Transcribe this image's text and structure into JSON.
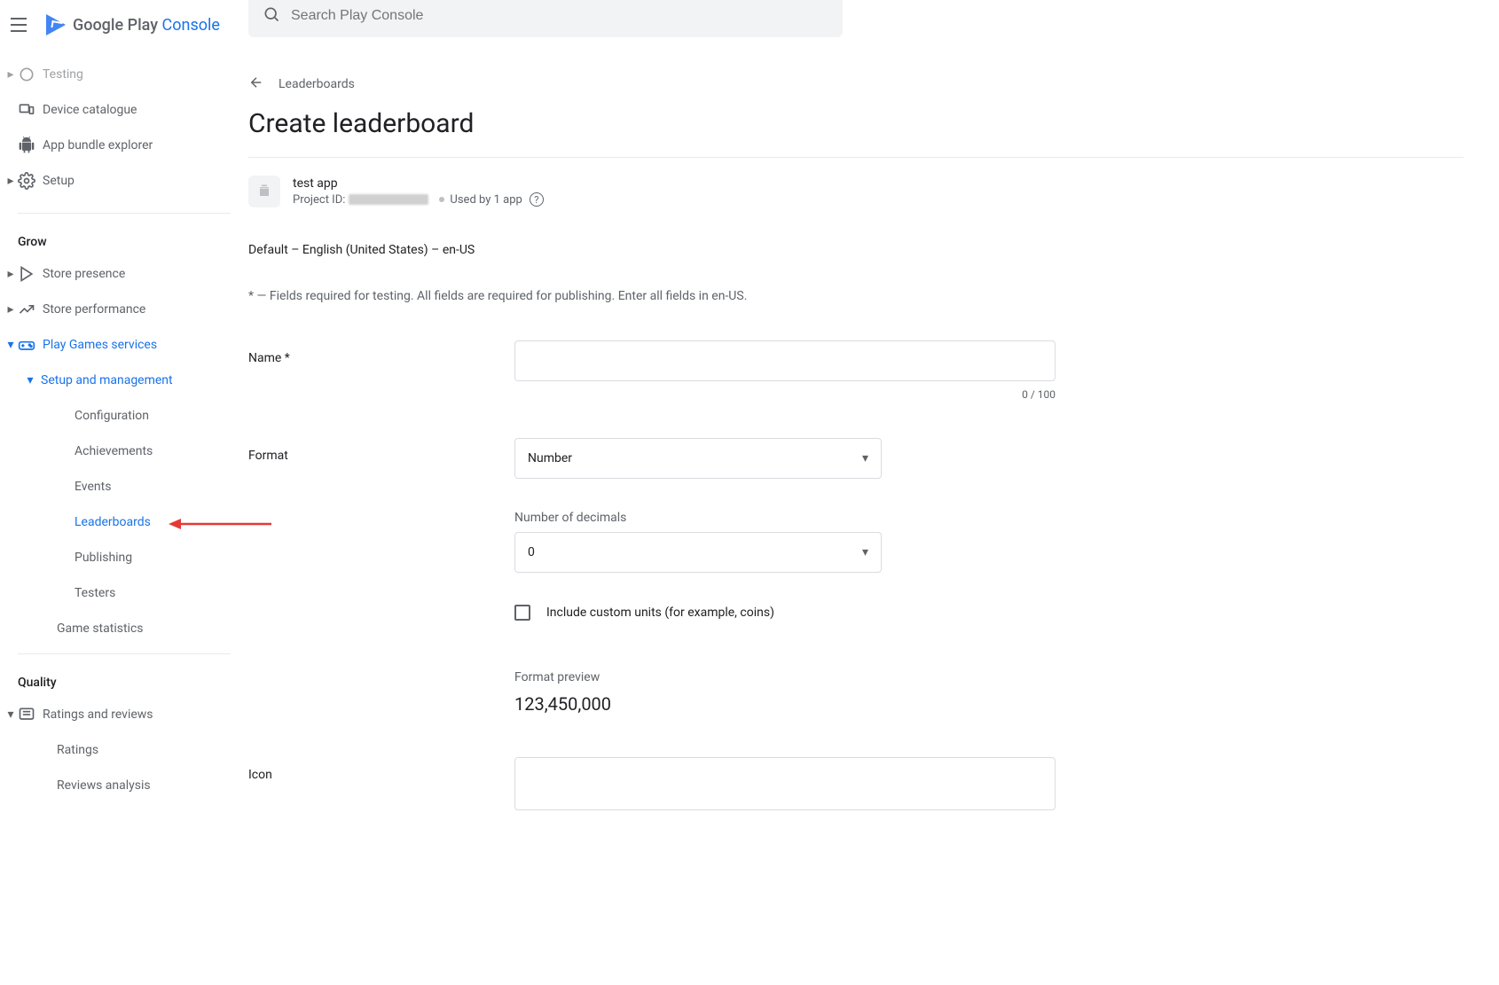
{
  "logo": {
    "text1": "Google Play ",
    "text2": "Console"
  },
  "search": {
    "placeholder": "Search Play Console"
  },
  "sidebar": {
    "top_items": [
      {
        "label": "Testing"
      },
      {
        "label": "Device catalogue"
      },
      {
        "label": "App bundle explorer"
      },
      {
        "label": "Setup"
      }
    ],
    "grow_heading": "Grow",
    "grow_items": [
      {
        "label": "Store presence"
      },
      {
        "label": "Store performance"
      },
      {
        "label": "Play Games services"
      }
    ],
    "setup_mgmt": "Setup and management",
    "sub_items": [
      {
        "label": "Configuration"
      },
      {
        "label": "Achievements"
      },
      {
        "label": "Events"
      },
      {
        "label": "Leaderboards"
      },
      {
        "label": "Publishing"
      },
      {
        "label": "Testers"
      }
    ],
    "game_stats": "Game statistics",
    "quality_heading": "Quality",
    "ratings_reviews": "Ratings and reviews",
    "ratings": "Ratings",
    "reviews_analysis": "Reviews analysis"
  },
  "breadcrumb": "Leaderboards",
  "page_title": "Create leaderboard",
  "app": {
    "name": "test app",
    "project_id_label": "Project ID:",
    "used_by": "Used by 1 app"
  },
  "locale_line": "Default – English (United States) – en-US",
  "required_hint": "* — Fields required for testing. All fields are required for publishing. Enter all fields in en-US.",
  "form": {
    "name_label": "Name  *",
    "name_value": "",
    "name_count": "0 / 100",
    "format_label": "Format",
    "format_value": "Number",
    "decimals_label": "Number of decimals",
    "decimals_value": "0",
    "custom_units_label": "Include custom units (for example, coins)",
    "preview_label": "Format preview",
    "preview_value": "123,450,000",
    "icon_label": "Icon"
  }
}
